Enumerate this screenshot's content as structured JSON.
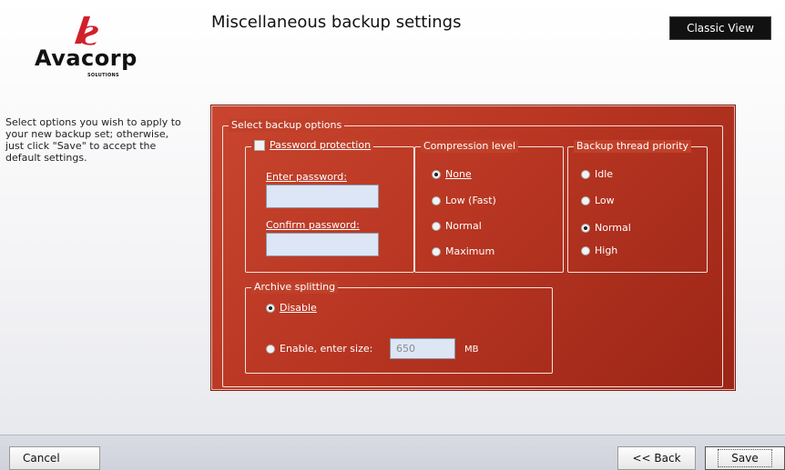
{
  "brand": {
    "logo_icon": "avacorp-logo-icon",
    "name": "Avacorp",
    "tagline": "SOLUTIONS"
  },
  "header": {
    "title": "Miscellaneous backup settings",
    "classic_view_label": "Classic View"
  },
  "instructions": "Select options you wish to apply to your new backup set; otherwise, just click \"Save\" to accept the default settings.",
  "panel": {
    "title": "Select backup options",
    "password": {
      "checkbox_label": "Password protection",
      "checked": false,
      "enter_label": "Enter password:",
      "enter_value": "",
      "confirm_label": "Confirm password:",
      "confirm_value": ""
    },
    "compression": {
      "title": "Compression level",
      "options": [
        "None",
        "Low (Fast)",
        "Normal",
        "Maximum"
      ],
      "selected": "None"
    },
    "priority": {
      "title": "Backup thread priority",
      "options": [
        "Idle",
        "Low",
        "Normal",
        "High"
      ],
      "selected": "Normal"
    },
    "splitting": {
      "title": "Archive splitting",
      "disable_label": "Disable",
      "enable_label": "Enable, enter size:",
      "selected": "Disable",
      "size_value": "650",
      "size_unit": "MB"
    }
  },
  "footer": {
    "cancel_label": "Cancel",
    "back_label": "<< Back",
    "save_label": "Save"
  },
  "colors": {
    "panel_red": "#b83622",
    "classic_bg": "#111111",
    "logo_red": "#d0202a"
  }
}
